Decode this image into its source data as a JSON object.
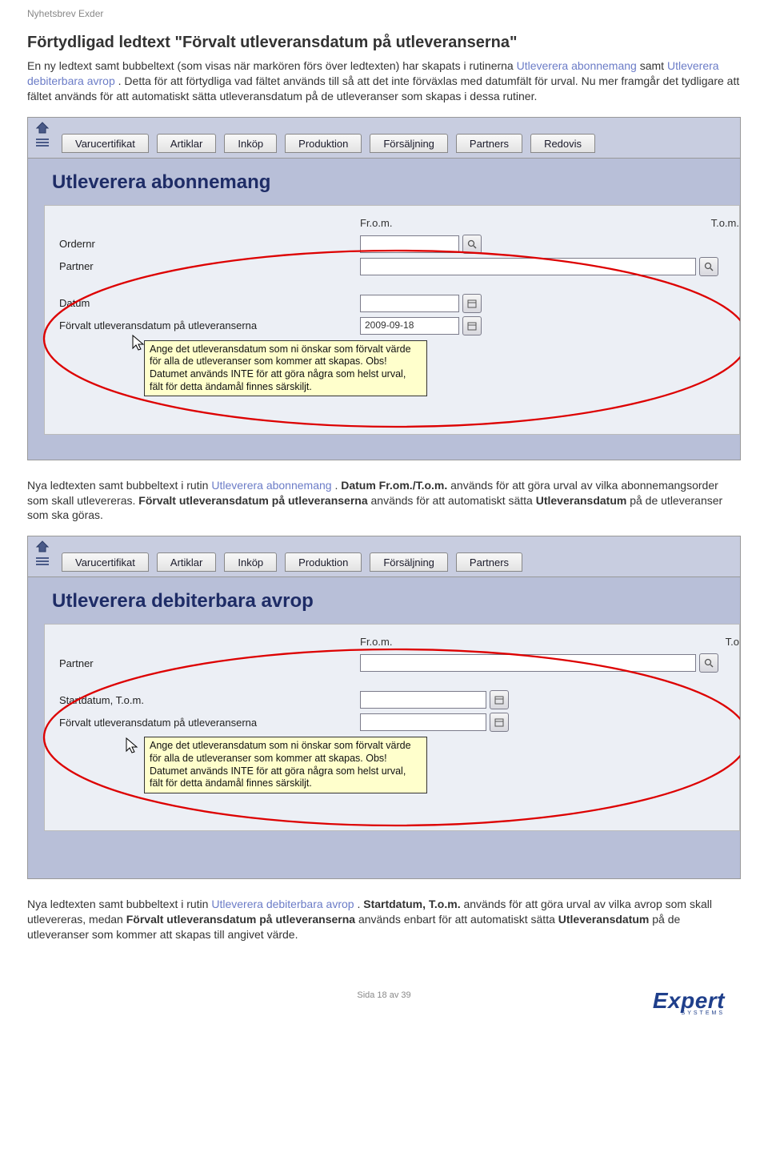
{
  "doc_header": "Nyhetsbrev Exder",
  "title": "Förtydligad ledtext \"Förvalt utleveransdatum på utleveranserna\"",
  "intro": {
    "pre": "En ny ledtext samt bubbeltext (som visas när markören förs över ledtexten) har skapats i rutinerna ",
    "link1": "Utleverera abonnemang",
    "mid1": " samt ",
    "link2": "Utleverera debiterbara avrop",
    "post": ". Detta för att förtydliga vad fältet används till så att det inte förväxlas med datumfält för urval. Nu mer framgår det tydligare att fältet används för att automatiskt sätta utleveransdatum på de utleveranser som skapas i dessa rutiner."
  },
  "tabs1": [
    "Varucertifikat",
    "Artiklar",
    "Inköp",
    "Produktion",
    "Försäljning",
    "Partners",
    "Redovis"
  ],
  "tabs2": [
    "Varucertifikat",
    "Artiklar",
    "Inköp",
    "Produktion",
    "Försäljning",
    "Partners"
  ],
  "shot1": {
    "heading": "Utleverera abonnemang",
    "col_a": "Fr.o.m.",
    "col_b": "T.o.m.",
    "label_ordernr": "Ordernr",
    "label_partner": "Partner",
    "label_datum": "Datum",
    "label_forvalt": "Förvalt utleveransdatum på utleveranserna",
    "date_value": "2009-09-18",
    "tooltip": "Ange det utleveransdatum som ni önskar som förvalt värde för alla de utleveranser som kommer att skapas. Obs! Datumet används INTE för att göra några som helst urval, fält för detta ändamål finnes särskiljt."
  },
  "mid_para": {
    "pre": "Nya ledtexten samt bubbeltext i rutin ",
    "link": "Utleverera abonnemang",
    "dot": ". ",
    "bold1": "Datum Fr.om./T.o.m.",
    "txt1": " används för att göra urval av vilka abonnemangsorder som skall utlevereras. ",
    "bold2": "Förvalt utleveransdatum på utleveranserna",
    "txt2": " används för att automatiskt sätta ",
    "bold3": "Utleveransdatum",
    "txt3": " på de utleveranser som ska göras."
  },
  "shot2": {
    "heading": "Utleverera debiterbara avrop",
    "col_a": "Fr.o.m.",
    "col_b": "T.o",
    "label_partner": "Partner",
    "label_start": "Startdatum, T.o.m.",
    "label_forvalt": "Förvalt utleveransdatum på utleveranserna",
    "tooltip": "Ange det utleveransdatum som ni önskar som förvalt värde för alla de utleveranser som kommer att skapas. Obs! Datumet används INTE för att göra några som helst urval, fält för detta ändamål finnes särskiljt."
  },
  "end_para": {
    "pre": "Nya ledtexten samt bubbeltext i rutin ",
    "link": "Utleverera debiterbara avrop",
    "dot": ". ",
    "bold1": "Startdatum, T.o.m.",
    "txt1": " används för att göra urval av vilka avrop som skall utlevereras, medan ",
    "bold2": "Förvalt utleveransdatum på utleveranserna",
    "txt2": " används enbart för att automatiskt sätta ",
    "bold3": "Utleveransdatum",
    "txt3": " på de utleveranser som kommer att skapas till angivet värde."
  },
  "footer": "Sida 18 av 39",
  "logo": "Expert",
  "logo_sub": "SYSTEMS"
}
